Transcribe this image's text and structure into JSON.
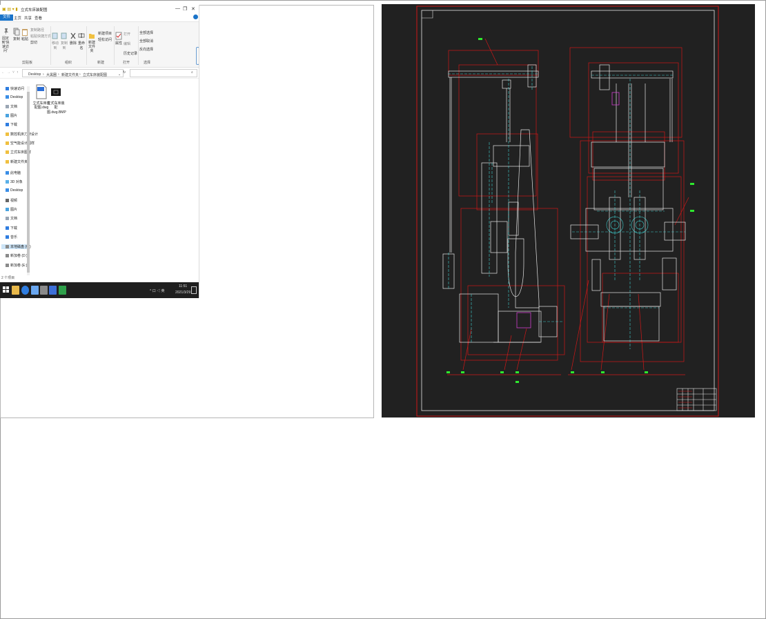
{
  "explorer": {
    "title": "立式车床装配图",
    "window_buttons": [
      "—",
      "❐",
      "✕"
    ],
    "menu": {
      "file": "文件",
      "home": "主页",
      "share": "共享",
      "view": "查看"
    },
    "ribbon": {
      "pin_label": "固定到'快速访问'",
      "copy": "复制",
      "paste": "粘贴",
      "copy_path": "复制路径",
      "paste_shortcut": "粘贴快捷方式",
      "cut": "剪切",
      "move_to": "移动到",
      "copy_to": "复制到",
      "delete": "删除",
      "rename": "重命名",
      "new_folder": "新建文件夹",
      "new_item": "新建项目",
      "easy_access": "轻松访问",
      "properties": "属性",
      "open": "打开",
      "edit": "编辑",
      "history": "历史记录",
      "select_all": "全部选择",
      "select_none": "全部取消",
      "invert_selection": "反向选择",
      "groups": {
        "clipboard": "剪贴板",
        "organize": "组织",
        "new": "新建",
        "open": "打开",
        "select": "选择"
      }
    },
    "address": {
      "crumbs": [
        "Desktop",
        "大黑圈",
        "新建文件夹",
        "立式车床装配图"
      ]
    },
    "nav": [
      {
        "label": "快速访问",
        "icon": "star-icon"
      },
      {
        "label": "Desktop",
        "icon": "desktop-icon"
      },
      {
        "label": "文档",
        "icon": "document-icon"
      },
      {
        "label": "图片",
        "icon": "picture-icon"
      },
      {
        "label": "下载",
        "icon": "download-icon"
      },
      {
        "label": "数控机床刀架设计",
        "icon": "folder-icon"
      },
      {
        "label": "空气能设计图样",
        "icon": "folder-icon"
      },
      {
        "label": "立式车床图样",
        "icon": "folder-icon"
      },
      {
        "label": "新建文件夹",
        "icon": "folder-icon"
      },
      {
        "label": "此电脑",
        "icon": "computer-icon"
      },
      {
        "label": "3D 对象",
        "icon": "cube-icon"
      },
      {
        "label": "Desktop",
        "icon": "desktop-icon"
      },
      {
        "label": "视频",
        "icon": "video-icon"
      },
      {
        "label": "图片",
        "icon": "picture-icon"
      },
      {
        "label": "文档",
        "icon": "document-icon"
      },
      {
        "label": "下载",
        "icon": "download-icon"
      },
      {
        "label": "音乐",
        "icon": "music-icon"
      },
      {
        "label": "本地磁盘 (C:)",
        "icon": "drive-icon"
      },
      {
        "label": "新加卷 (D:)",
        "icon": "drive-icon"
      },
      {
        "label": "新加卷 (E:)",
        "icon": "drive-icon"
      }
    ],
    "files": [
      {
        "name": "立式车床装配图.dwg",
        "type": "dwg"
      },
      {
        "name": "立式车床装配图.dwg.BMP",
        "type": "bmp"
      }
    ],
    "status": "2 个项目"
  },
  "taskbar": {
    "time": "11:51",
    "date": "2021/3/29",
    "tray_text": "^ 口 ◁ 英"
  },
  "colors": {
    "accent": "#1a73c8",
    "cad_bg": "#212121",
    "cad_red": "#d01818",
    "cad_cyan": "#3fd0d0",
    "cad_white": "#e6e6e6",
    "cad_green": "#2ee82e",
    "cad_magenta": "#d040d0"
  }
}
